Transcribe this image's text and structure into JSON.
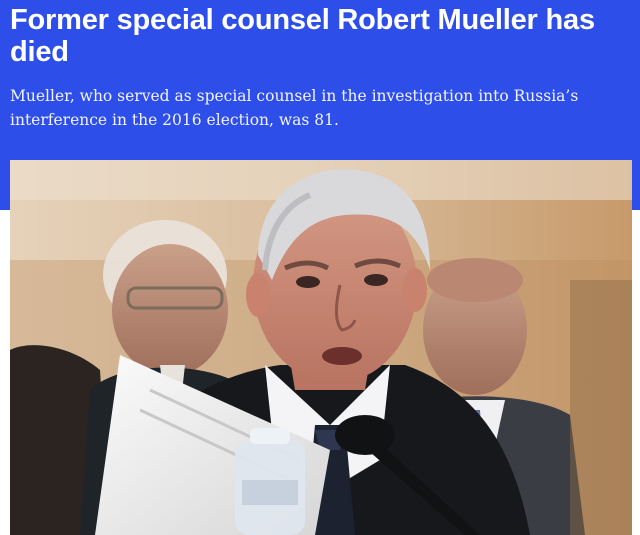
{
  "article": {
    "headline": "Former special counsel Robert Mueller has died",
    "dek": "Mueller, who served as special counsel in the investigation into Russia’s interference in the 2016 election, was 81."
  },
  "photo": {
    "subject": "robert-mueller-testifying"
  },
  "colors": {
    "hero_background": "#2d4ee8",
    "headline_text": "#ffffff",
    "dek_text": "#f1f3ff"
  }
}
